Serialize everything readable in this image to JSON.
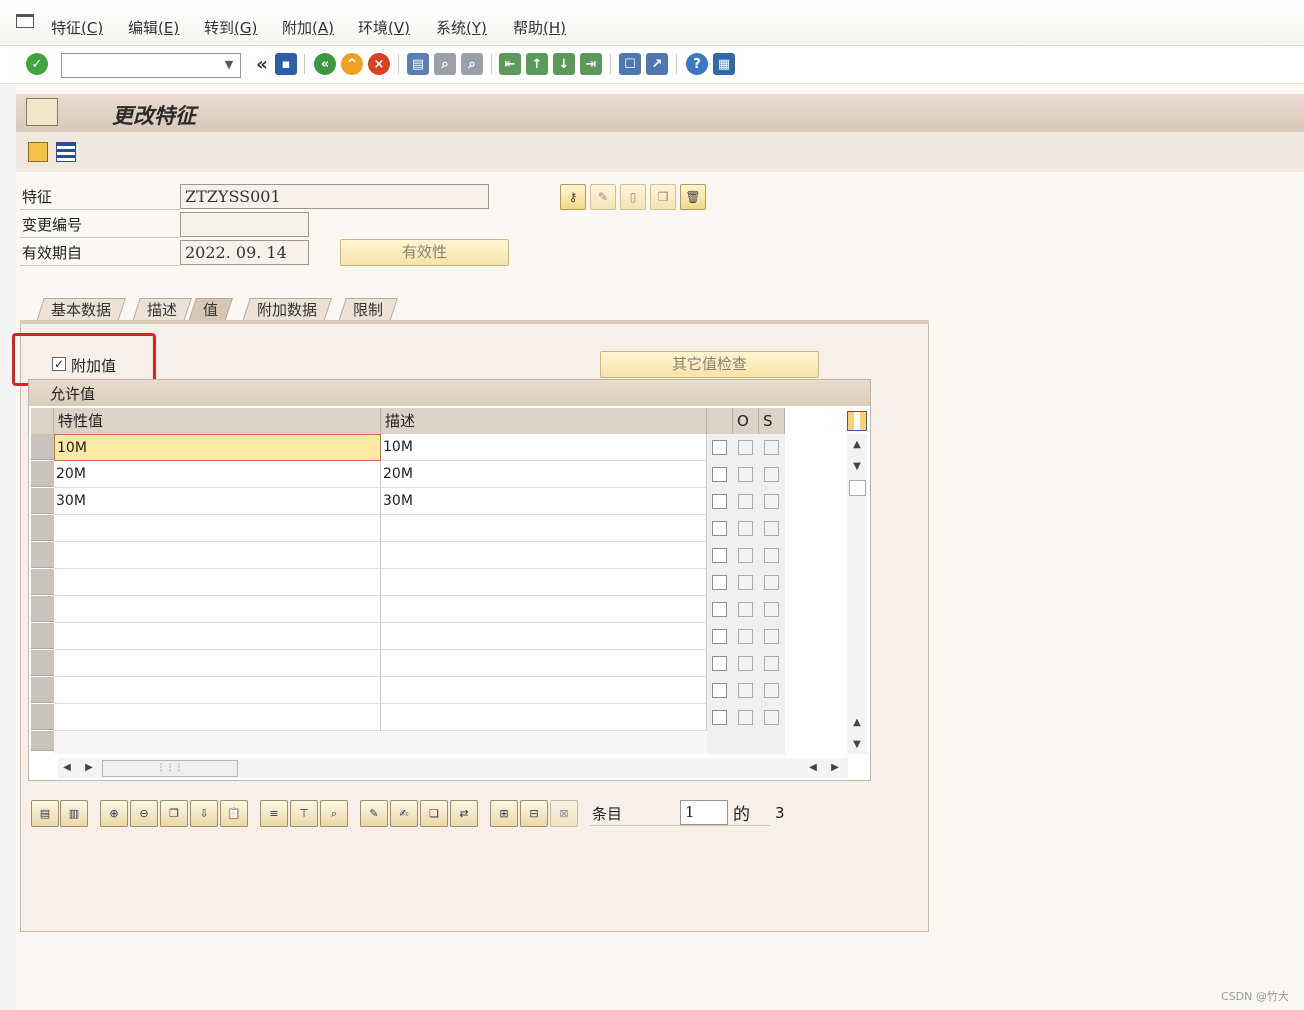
{
  "menu": [
    {
      "label": "特征",
      "key": "(C)"
    },
    {
      "label": "编辑",
      "key": "(E)"
    },
    {
      "label": "转到",
      "key": "(G)"
    },
    {
      "label": "附加",
      "key": "(A)"
    },
    {
      "label": "环境",
      "key": "(V)"
    },
    {
      "label": "系统",
      "key": "(Y)"
    },
    {
      "label": "帮助",
      "key": "(H)"
    }
  ],
  "toolbar": {
    "command_value": "",
    "back_label": "«",
    "icons": [
      "enter-icon",
      "save-icon",
      "back-icon",
      "exit-icon",
      "cancel-icon",
      "print-icon",
      "find-icon",
      "find-next-icon",
      "first-page-icon",
      "prev-page-icon",
      "next-page-icon",
      "last-page-icon",
      "new-session-icon",
      "shortcut-icon",
      "help-icon",
      "customize-layout-icon"
    ]
  },
  "page_title": "更改特征",
  "header": {
    "characteristic_label": "特征",
    "characteristic_value": "ZTZYSS001",
    "change_number_label": "变更编号",
    "change_number_value": "",
    "valid_from_label": "有效期自",
    "valid_from_value": "2022. 09. 14",
    "validity_button": "有效性"
  },
  "tabs": [
    "基本数据",
    "描述",
    "值",
    "附加数据",
    "限制"
  ],
  "active_tab": "值",
  "values_tab": {
    "additional_values_label": "附加值",
    "additional_values_checked": true,
    "other_value_check_button": "其它值检查",
    "table_title": "允许值",
    "columns": {
      "value": "特性值",
      "description": "描述",
      "default": "",
      "o": "O",
      "s": "S"
    },
    "rows": [
      {
        "value": "10M",
        "description": "10M"
      },
      {
        "value": "20M",
        "description": "20M"
      },
      {
        "value": "30M",
        "description": "30M"
      }
    ]
  },
  "footer": {
    "entry_label": "条目",
    "entry_value": "1",
    "of_label": "的",
    "total": "3"
  },
  "watermark": "CSDN @竹大"
}
